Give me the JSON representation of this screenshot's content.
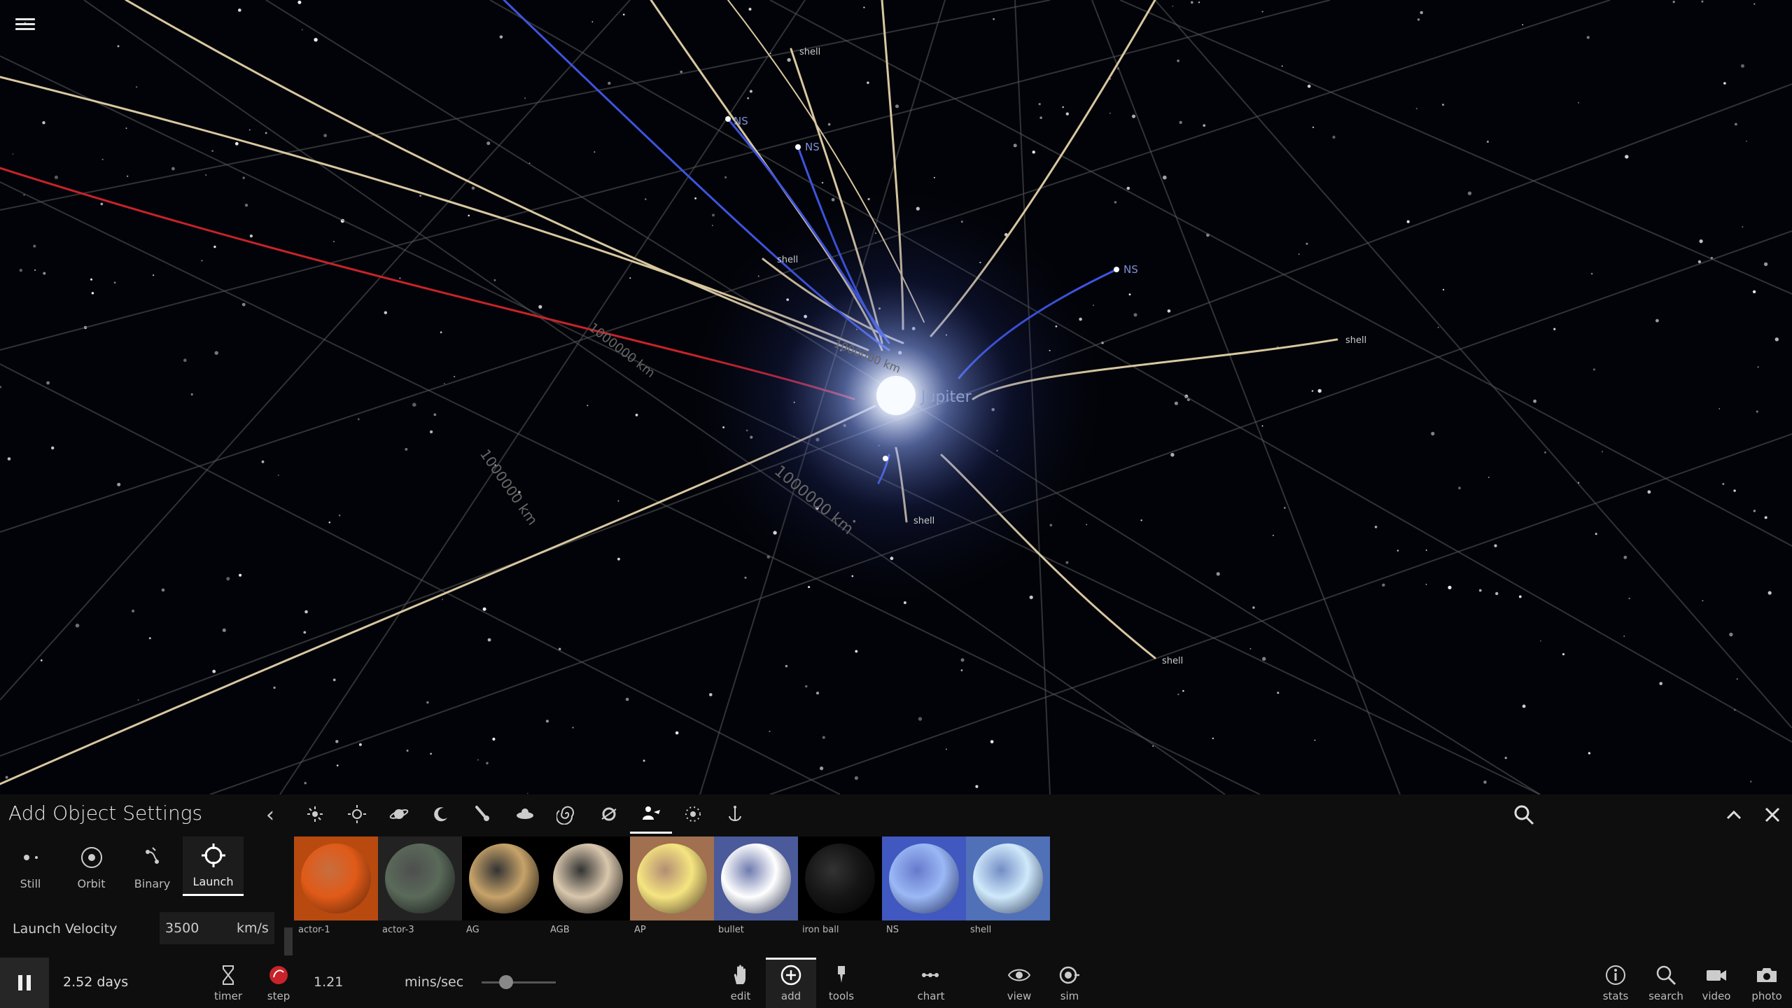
{
  "scene": {
    "labels": [
      {
        "text": "shell"
      },
      {
        "text": "NS"
      },
      {
        "text": "NS"
      },
      {
        "text": "shell"
      },
      {
        "text": "NS"
      },
      {
        "text": "shell"
      },
      {
        "text": "Jupiter"
      },
      {
        "text": "shell"
      },
      {
        "text": "shell"
      },
      {
        "text": "1000000 km"
      },
      {
        "text": "1000000 km"
      },
      {
        "text": "1000000 km"
      },
      {
        "text": "1000000 km"
      }
    ]
  },
  "panel": {
    "title": "Add Object Settings",
    "categories": [
      {
        "icon": "asteroid-burst-icon"
      },
      {
        "icon": "star-icon"
      },
      {
        "icon": "planet-icon"
      },
      {
        "icon": "moon-icon"
      },
      {
        "icon": "comet-icon"
      },
      {
        "icon": "ship-icon"
      },
      {
        "icon": "galaxy-icon"
      },
      {
        "icon": "ring-icon"
      },
      {
        "icon": "actor-icon"
      },
      {
        "icon": "particles-icon"
      },
      {
        "icon": "anchor-icon"
      }
    ],
    "modes": [
      {
        "label": "Still",
        "icon": "still-icon"
      },
      {
        "label": "Orbit",
        "icon": "orbit-icon"
      },
      {
        "label": "Binary",
        "icon": "binary-icon"
      },
      {
        "label": "Launch",
        "icon": "launch-icon"
      }
    ],
    "velocity": {
      "label": "Launch Velocity",
      "value": "3500",
      "unit": "km/s"
    },
    "objects": [
      {
        "label": "actor-1",
        "color": "#e05a18"
      },
      {
        "label": "actor-3",
        "color": "#5a6a5a"
      },
      {
        "label": "AG",
        "color": "#c7a36a"
      },
      {
        "label": "AGB",
        "color": "#d9c7ad"
      },
      {
        "label": "AP",
        "color": "#f5e580"
      },
      {
        "label": "bullet",
        "color": "#ffffff"
      },
      {
        "label": "iron ball",
        "color": "#161616"
      },
      {
        "label": "NS",
        "color": "#9bb8f5"
      },
      {
        "label": "shell",
        "color": "#cfe9fb"
      }
    ]
  },
  "toolbar": {
    "time": "2.52 days",
    "speed_value": "1.21",
    "speed_unit": "mins/sec",
    "slider_fraction": 0.33,
    "left_tools": [
      {
        "label": "timer",
        "icon": "hourglass-icon"
      },
      {
        "label": "step",
        "icon": "step-icon"
      }
    ],
    "center_tools": [
      {
        "label": "edit",
        "icon": "hand-icon"
      },
      {
        "label": "add",
        "icon": "add-circle-icon"
      },
      {
        "label": "tools",
        "icon": "tools-icon"
      },
      {
        "label": "chart",
        "icon": "chart-icon"
      },
      {
        "label": "view",
        "icon": "eye-icon"
      },
      {
        "label": "sim",
        "icon": "sim-icon"
      }
    ],
    "right_tools": [
      {
        "label": "stats",
        "icon": "info-icon"
      },
      {
        "label": "search",
        "icon": "search-icon"
      },
      {
        "label": "video",
        "icon": "video-camera-icon"
      },
      {
        "label": "photo",
        "icon": "camera-icon"
      }
    ]
  }
}
